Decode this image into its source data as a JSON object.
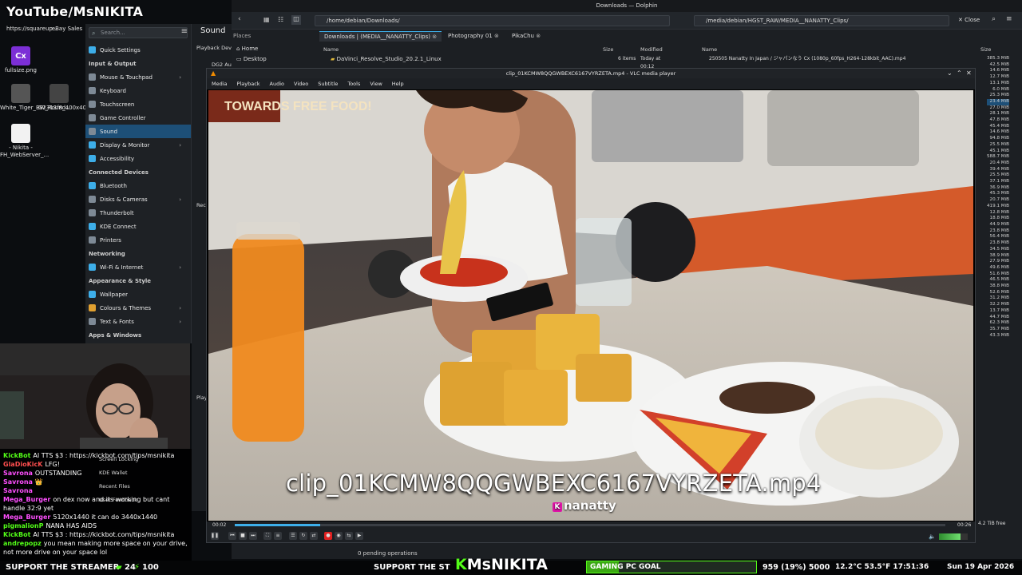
{
  "stream_overlay": {
    "channel_title": "YouTube/MsNIKITA",
    "brand": "MsNIKITA",
    "brand_prefix": "K",
    "support_text": "SUPPORT THE STREAMER",
    "support_text2": "SUPPORT THE ST",
    "viewers": "24",
    "viewers_icon": "kick-logo-icon",
    "hundred": "100",
    "goal_label": "GAMING PC GOAL",
    "goal_progress": "959 (19%) 5000",
    "goal_fraction": 0.19,
    "stats": "12.2°C 53.5°F 17:51:36",
    "date": "Sun 19 Apr 2026",
    "accent_color": "#53fc18"
  },
  "desktop": {
    "icons": [
      {
        "label": "https://squareup...",
        "icon": "link-icon"
      },
      {
        "label": "eBay Sales",
        "icon": "ebay-icon"
      },
      {
        "label": "fullsize.png",
        "glyph": "Cx",
        "icon": "image-icon"
      },
      {
        "label": "White_Tiger_BW_Round...",
        "icon": "tiger-icon"
      },
      {
        "label": "G2313f8_400x400.jpg",
        "icon": "photo-icon"
      },
      {
        "label": "- Nikita - FH_WebServer_...",
        "icon": "document-icon"
      }
    ]
  },
  "settings": {
    "search_placeholder": "Search...",
    "page_title": "Sound",
    "items": [
      {
        "label": "Quick Settings",
        "type": "item",
        "color": "#3daee9"
      },
      {
        "label": "Input & Output",
        "type": "header"
      },
      {
        "label": "Mouse & Touchpad",
        "type": "item",
        "color": "#7e8a96",
        "chevron": true
      },
      {
        "label": "Keyboard",
        "type": "item",
        "color": "#7e8a96"
      },
      {
        "label": "Touchscreen",
        "type": "item",
        "color": "#7e8a96"
      },
      {
        "label": "Game Controller",
        "type": "item",
        "color": "#7e8a96"
      },
      {
        "label": "Sound",
        "type": "item",
        "color": "#7e8a96",
        "active": true
      },
      {
        "label": "Display & Monitor",
        "type": "item",
        "color": "#3daee9",
        "chevron": true
      },
      {
        "label": "Accessibility",
        "type": "item",
        "color": "#3daee9"
      },
      {
        "label": "Connected Devices",
        "type": "header"
      },
      {
        "label": "Bluetooth",
        "type": "item",
        "color": "#3daee9"
      },
      {
        "label": "Disks & Cameras",
        "type": "item",
        "color": "#7e8a96",
        "chevron": true
      },
      {
        "label": "Thunderbolt",
        "type": "item",
        "color": "#7e8a96"
      },
      {
        "label": "KDE Connect",
        "type": "item",
        "color": "#3daee9"
      },
      {
        "label": "Printers",
        "type": "item",
        "color": "#7e8a96"
      },
      {
        "label": "Networking",
        "type": "header"
      },
      {
        "label": "Wi-Fi & Internet",
        "type": "item",
        "color": "#3daee9",
        "chevron": true
      },
      {
        "label": "Appearance & Style",
        "type": "header"
      },
      {
        "label": "Wallpaper",
        "type": "item",
        "color": "#3daee9"
      },
      {
        "label": "Colours & Themes",
        "type": "item",
        "color": "#e0a030",
        "chevron": true
      },
      {
        "label": "Text & Fonts",
        "type": "item",
        "color": "#7e8a96",
        "chevron": true
      },
      {
        "label": "Apps & Windows",
        "type": "header"
      }
    ],
    "lower_items": [
      "Screen Locking",
      "KDE Wallet",
      "Recent Files",
      "User Feedback"
    ],
    "sound_labels": [
      "Playback Dev",
      "DG2 Au",
      "Recording",
      "Play"
    ]
  },
  "dolphin": {
    "title": "Downloads — Dolphin",
    "left_path": "/home/debian/Downloads/",
    "right_path": "/media/debian/HGST_RAW/MEDIA__NANATTY_Clips/",
    "close_label": "Close",
    "places_label": "Places",
    "places": [
      "Home",
      "Desktop"
    ],
    "tabs": [
      "Downloads | (MEDIA__NANATTY_Clips)",
      "Photography 01",
      "PikaChu"
    ],
    "columns_left": [
      "Name",
      "Size",
      "Modified"
    ],
    "columns_right": [
      "Name",
      "Size"
    ],
    "left_rows": [
      {
        "name": "DaVinci_Resolve_Studio_20.2.1_Linux",
        "size": "6 items",
        "modified": "Today at 00:12"
      }
    ],
    "right_rows": [
      {
        "name": "250505 Nanatty In Japan / ジャパンなう Cx (1080p_60fps_H264-128kbit_AAC).mp4",
        "size": "385.3 MiB"
      }
    ],
    "sizes": [
      "385.3 MiB",
      "42.5 MiB",
      "14.6 MiB",
      "12.7 MiB",
      "13.1 MiB",
      "6.0 MiB",
      "25.3 MiB",
      "23.4 MiB",
      "27.0 MiB",
      "28.1 MiB",
      "47.8 MiB",
      "45.4 MiB",
      "14.6 MiB",
      "94.8 MiB",
      "25.5 MiB",
      "45.1 MiB",
      "588.7 MiB",
      "20.4 MiB",
      "39.4 MiB",
      "25.5 MiB",
      "37.1 MiB",
      "36.9 MiB",
      "45.3 MiB",
      "20.7 MiB",
      "419.1 MiB",
      "12.8 MiB",
      "18.8 MiB",
      "44.9 MiB",
      "23.8 MiB",
      "56.4 MiB",
      "23.8 MiB",
      "34.5 MiB",
      "38.9 MiB",
      "27.9 MiB",
      "49.6 MiB",
      "51.6 MiB",
      "46.5 MiB",
      "38.8 MiB",
      "52.6 MiB",
      "31.2 MiB",
      "32.2 MiB",
      "13.7 MiB",
      "44.7 MiB",
      "62.3 MiB",
      "35.7 MiB",
      "43.3 MiB"
    ],
    "selected_size_index": 7,
    "free_space": "4.2 TiB free",
    "pending": "0 pending operations"
  },
  "vlc": {
    "title": "clip_01KCMW8QQGWBEXC6167VYRZETA.mp4 - VLC media player",
    "menu": [
      "Media",
      "Playback",
      "Audio",
      "Video",
      "Subtitle",
      "Tools",
      "View",
      "Help"
    ],
    "time_elapsed": "00:02",
    "time_total": "00:26",
    "seek_progress": 0.12,
    "volume_level": 0.75,
    "overlay_filename": "clip_01KCMW8QQGWBEXC6167VYRZETA.mp4",
    "overlay_handle": "nanatty",
    "restaurant_sign": "TOWARDS FREE FOOD!"
  },
  "chat": [
    {
      "user": "KickBot",
      "color": "#53fc18",
      "msg": "AI TTS $3 : https://kickbot.com/tips/msnikita"
    },
    {
      "user": "GlaDioKicK",
      "color": "#ff4f4f",
      "msg": "LFG!"
    },
    {
      "user": "Savrona",
      "color": "#ff4fff",
      "msg": "OUTSTANDING"
    },
    {
      "user": "Savrona",
      "color": "#ff4fff",
      "msg": "👑"
    },
    {
      "user": "Savrona",
      "color": "#ff4fff",
      "msg": ""
    },
    {
      "user": "Mega_Burger",
      "color": "#ff4fff",
      "msg": "on dex now and its working but cant handle 32:9 yet"
    },
    {
      "user": "Mega_Burger",
      "color": "#ff4fff",
      "msg": "5120x1440 it can do 3440x1440"
    },
    {
      "user": "pigmalionP",
      "color": "#53fc18",
      "msg": "NANA HAS AIDS"
    },
    {
      "user": "KickBot",
      "color": "#53fc18",
      "msg": "AI TTS $3 : https://kickbot.com/tips/msnikita"
    },
    {
      "user": "andrepopz",
      "color": "#53fc18",
      "msg": "you mean making more space on your drive, not more drive on your space lol"
    }
  ]
}
